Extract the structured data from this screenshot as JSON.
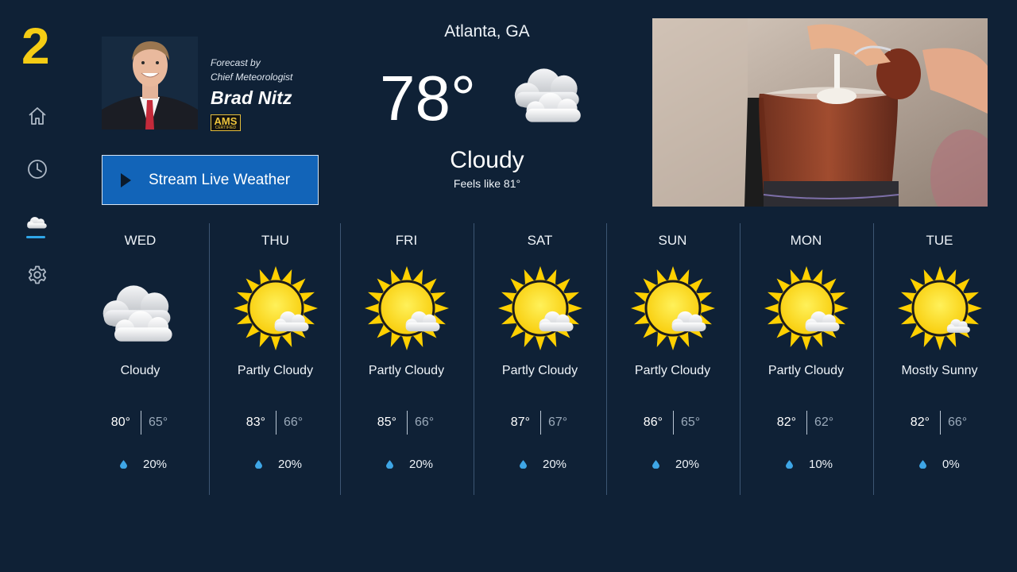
{
  "app": {
    "logo": "2"
  },
  "nav": [
    {
      "icon": "home-icon",
      "label": "Home"
    },
    {
      "icon": "clock-icon",
      "label": "Recent"
    },
    {
      "icon": "weather-icon",
      "label": "Weather",
      "selected": true
    },
    {
      "icon": "gear-icon",
      "label": "Settings"
    }
  ],
  "meteorologist": {
    "byline_1": "Forecast by",
    "byline_2": "Chief Meteorologist",
    "name": "Brad Nitz",
    "badge_main": "AMS",
    "badge_sub": "CERTIFIED"
  },
  "stream_button": {
    "label": "Stream Live Weather"
  },
  "current": {
    "city": "Atlanta, GA",
    "temperature": "78°",
    "condition": "Cloudy",
    "feels_like": "Feels like 81°",
    "icon": "cloudy-icon"
  },
  "colors": {
    "background": "#0f2136",
    "logo": "#f5cc14",
    "button": "#1264b8",
    "accent": "#2fa6e8",
    "sun": "#ffd60a"
  },
  "forecast": [
    {
      "day": "WED",
      "condition": "Cloudy",
      "high": "80°",
      "low": "65°",
      "precip": "20%",
      "icon": "cloudy-icon"
    },
    {
      "day": "THU",
      "condition": "Partly Cloudy",
      "high": "83°",
      "low": "66°",
      "precip": "20%",
      "icon": "partly-cloudy-icon"
    },
    {
      "day": "FRI",
      "condition": "Partly Cloudy",
      "high": "85°",
      "low": "66°",
      "precip": "20%",
      "icon": "partly-cloudy-icon"
    },
    {
      "day": "SAT",
      "condition": "Partly Cloudy",
      "high": "87°",
      "low": "67°",
      "precip": "20%",
      "icon": "partly-cloudy-icon"
    },
    {
      "day": "SUN",
      "condition": "Partly Cloudy",
      "high": "86°",
      "low": "65°",
      "precip": "20%",
      "icon": "partly-cloudy-icon"
    },
    {
      "day": "MON",
      "condition": "Partly Cloudy",
      "high": "82°",
      "low": "62°",
      "precip": "10%",
      "icon": "partly-cloudy-icon"
    },
    {
      "day": "TUE",
      "condition": "Mostly Sunny",
      "high": "82°",
      "low": "66°",
      "precip": "0%",
      "icon": "mostly-sunny-icon"
    }
  ]
}
